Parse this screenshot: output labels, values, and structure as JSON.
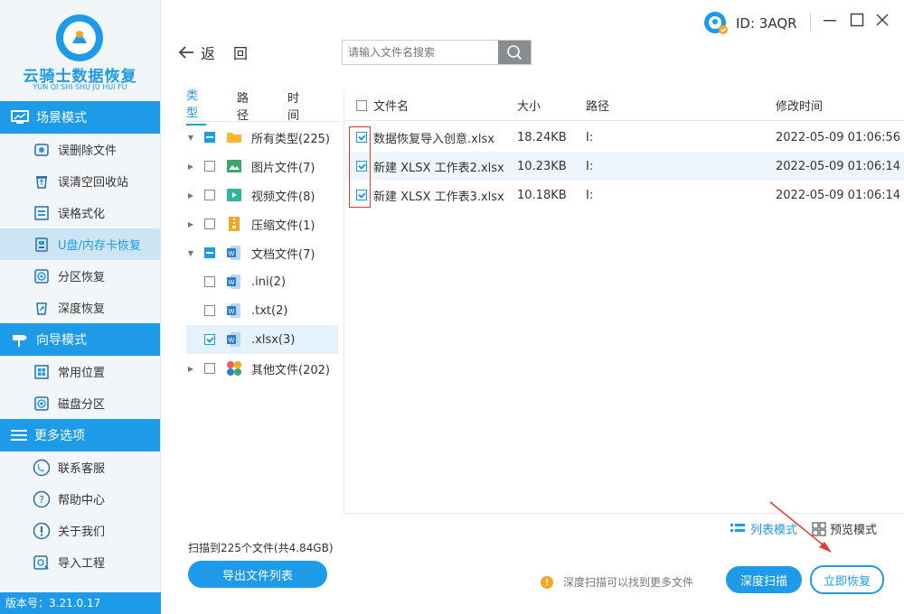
{
  "brand": {
    "title": "云骑士数据恢复",
    "subtitle": "YUN QI SHI SHU JU HUI FU"
  },
  "sidebar": {
    "section1": "场景模式",
    "section1_items": [
      {
        "label": "误删除文件",
        "icon": "delete-file-icon"
      },
      {
        "label": "误清空回收站",
        "icon": "recycle-bin-icon"
      },
      {
        "label": "误格式化",
        "icon": "format-icon"
      },
      {
        "label": "U盘/内存卡恢复",
        "icon": "usb-card-icon"
      },
      {
        "label": "分区恢复",
        "icon": "partition-icon"
      },
      {
        "label": "深度恢复",
        "icon": "deep-recovery-icon"
      }
    ],
    "section2": "向导模式",
    "section2_items": [
      {
        "label": "常用位置",
        "icon": "windows-icon"
      },
      {
        "label": "磁盘分区",
        "icon": "disk-icon"
      }
    ],
    "section3": "更多选项",
    "section3_items": [
      {
        "label": "联系客服",
        "icon": "phone-icon"
      },
      {
        "label": "帮助中心",
        "icon": "help-icon"
      },
      {
        "label": "关于我们",
        "icon": "info-icon"
      },
      {
        "label": "导入工程",
        "icon": "import-icon"
      }
    ],
    "version": "版本号：3.21.0.17"
  },
  "header": {
    "user_id": "ID: 3AQR"
  },
  "nav": {
    "back": "返",
    "back2": "回",
    "search_placeholder": "请输入文件名搜索"
  },
  "tree": {
    "tabs": [
      "类型",
      "路径",
      "时间"
    ],
    "rows": [
      {
        "label": "所有类型(225)"
      },
      {
        "label": "图片文件(7)"
      },
      {
        "label": "视频文件(8)"
      },
      {
        "label": "压缩文件(1)"
      },
      {
        "label": "文档文件(7)"
      },
      {
        "label": ".ini(2)"
      },
      {
        "label": ".txt(2)"
      },
      {
        "label": ".xlsx(3)"
      },
      {
        "label": "其他文件(202)"
      }
    ]
  },
  "table": {
    "columns": [
      "文件名",
      "大小",
      "路径",
      "修改时间"
    ],
    "rows": [
      {
        "name": "数据恢复导入创意.xlsx",
        "size": "18.24KB",
        "path": "I:",
        "time": "2022-05-09 01:06:56"
      },
      {
        "name": "新建 XLSX 工作表2.xlsx",
        "size": "10.23KB",
        "path": "I:",
        "time": "2022-05-09 01:06:14"
      },
      {
        "name": "新建 XLSX 工作表3.xlsx",
        "size": "10.18KB",
        "path": "I:",
        "time": "2022-05-09 01:06:14"
      }
    ]
  },
  "view": {
    "list": "列表模式",
    "preview": "预览模式"
  },
  "footer": {
    "scan_info": "扫描到225个文件(共4.84GB)",
    "export": "导出文件列表",
    "hint": "深度扫描可以找到更多文件",
    "deep_scan": "深度扫描",
    "recover": "立即恢复"
  },
  "colors": {
    "accent": "#1e9be8",
    "annotation": "#e53935",
    "warning": "#f5a623"
  }
}
